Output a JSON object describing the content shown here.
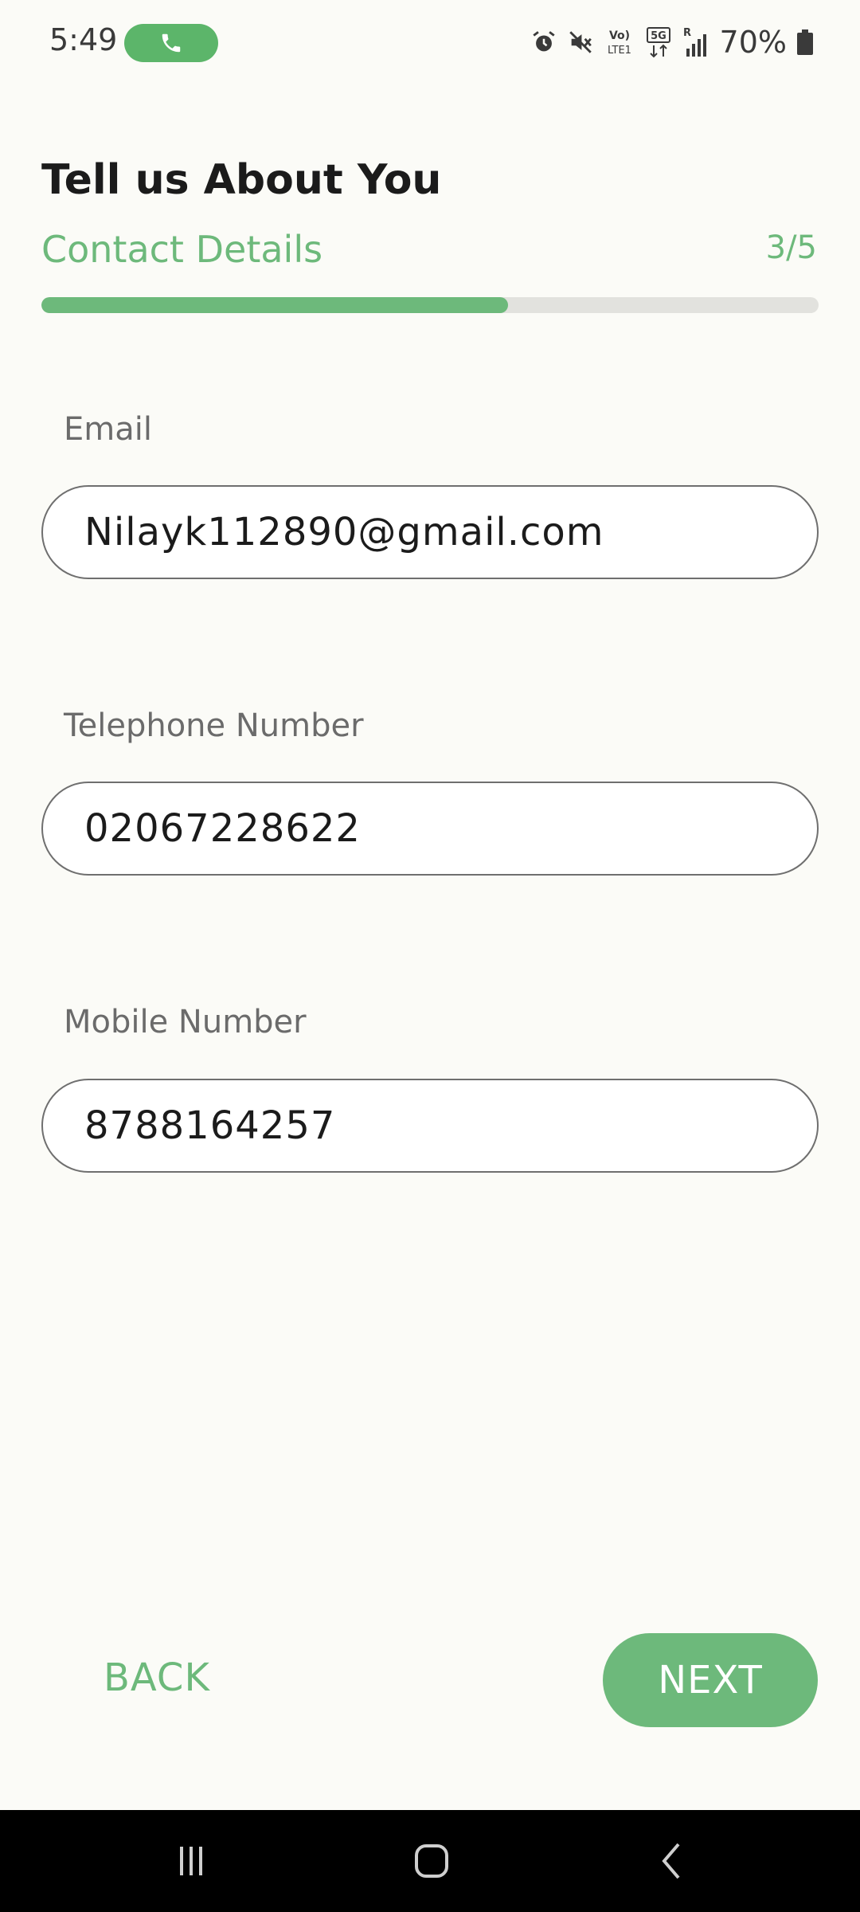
{
  "status_bar": {
    "time": "5:49",
    "battery": "70%",
    "icons": [
      "phone-call-icon",
      "alarm-icon",
      "mute-icon",
      "volte-icon",
      "5g-icon",
      "signal-icon",
      "battery-icon"
    ],
    "network_labels": {
      "volte_top": "Vo)",
      "volte_bottom": "LTE1",
      "net": "5G",
      "roaming": "R"
    }
  },
  "header": {
    "title": "Tell us About You",
    "step_title": "Contact Details",
    "step_counter": "3/5",
    "progress_fraction": 0.6
  },
  "form": {
    "email": {
      "label": "Email",
      "value": "Nilayk112890@gmail.com"
    },
    "telephone": {
      "label": "Telephone Number",
      "value": "02067228622"
    },
    "mobile": {
      "label": "Mobile Number",
      "value": "8788164257"
    }
  },
  "actions": {
    "back_label": "BACK",
    "next_label": "NEXT"
  },
  "nav_bar": {
    "icons": [
      "recent-apps-icon",
      "home-icon",
      "back-icon"
    ]
  },
  "colors": {
    "accent": "#6DB97B",
    "background": "#FBFBF7",
    "call_pill": "#5CB56A"
  }
}
